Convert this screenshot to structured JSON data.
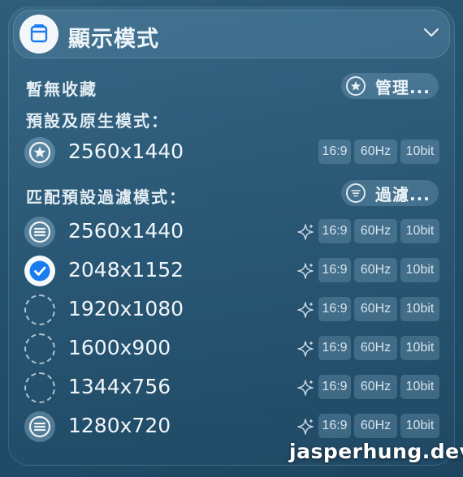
{
  "header": {
    "title": "顯示模式",
    "icon": "display-window-icon"
  },
  "favorites": {
    "empty_text": "暫無收藏",
    "manage_label": "管理..."
  },
  "presets": {
    "label": "預設及原生模式：",
    "items": [
      {
        "resolution": "2560x1440",
        "aspect": "16:9",
        "refresh": "60Hz",
        "depth": "10bit",
        "status": "star"
      }
    ]
  },
  "filtered": {
    "label": "匹配預設過濾模式：",
    "filter_label": "過濾...",
    "items": [
      {
        "resolution": "2560x1440",
        "aspect": "16:9",
        "refresh": "60Hz",
        "depth": "10bit",
        "status": "list"
      },
      {
        "resolution": "2048x1152",
        "aspect": "16:9",
        "refresh": "60Hz",
        "depth": "10bit",
        "status": "selected"
      },
      {
        "resolution": "1920x1080",
        "aspect": "16:9",
        "refresh": "60Hz",
        "depth": "10bit",
        "status": "dashed"
      },
      {
        "resolution": "1600x900",
        "aspect": "16:9",
        "refresh": "60Hz",
        "depth": "10bit",
        "status": "dashed"
      },
      {
        "resolution": "1344x756",
        "aspect": "16:9",
        "refresh": "60Hz",
        "depth": "10bit",
        "status": "dashed"
      },
      {
        "resolution": "1280x720",
        "aspect": "16:9",
        "refresh": "60Hz",
        "depth": "10bit",
        "status": "list"
      }
    ]
  },
  "watermark": "jasperhung.dev",
  "colors": {
    "accent": "#1a7cf0",
    "panel": "#23506d"
  }
}
